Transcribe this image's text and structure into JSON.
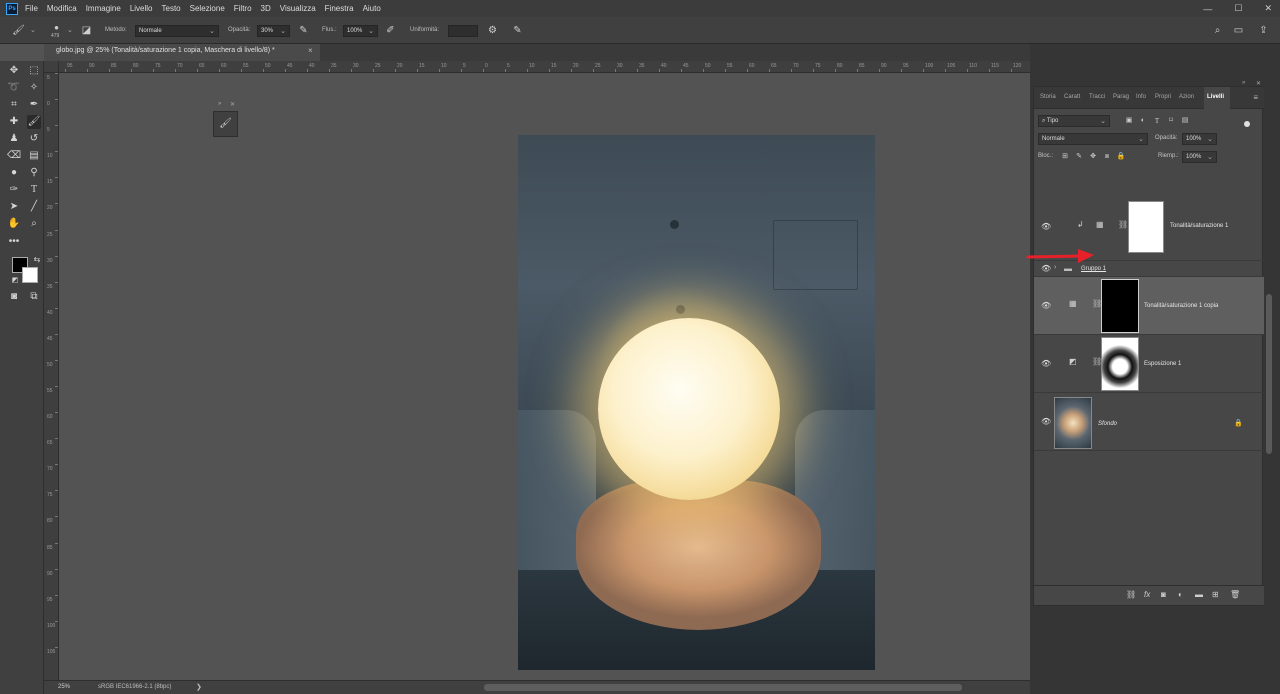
{
  "menubar": {
    "app_icon": "Ps",
    "items": [
      "File",
      "Modifica",
      "Immagine",
      "Livello",
      "Testo",
      "Selezione",
      "Filtro",
      "3D",
      "Visualizza",
      "Finestra",
      "Aiuto"
    ]
  },
  "options_bar": {
    "brush_size": "479",
    "mode_label": "Metodo:",
    "mode_value": "Normale",
    "opacity_label": "Opacità:",
    "opacity_value": "30%",
    "flow_label": "Flus.:",
    "flow_value": "100%",
    "smoothing_label": "Uniformità:"
  },
  "document": {
    "tab_title": "globo.jpg @ 25% (Tonalità/saturazione 1 copia, Maschera di livello/8) *",
    "close": "×"
  },
  "rulers": {
    "horizontal": [
      "95",
      "90",
      "85",
      "80",
      "75",
      "70",
      "65",
      "60",
      "55",
      "50",
      "45",
      "40",
      "35",
      "30",
      "25",
      "20",
      "15",
      "10",
      "5",
      "0",
      "5",
      "10",
      "15",
      "20",
      "25",
      "30",
      "35",
      "40",
      "45",
      "50",
      "55",
      "60",
      "65",
      "70",
      "75",
      "80",
      "85",
      "90",
      "95",
      "100",
      "105",
      "110",
      "115",
      "120"
    ],
    "vertical": [
      "5",
      "0",
      "5",
      "10",
      "15",
      "20",
      "25",
      "30",
      "35",
      "40",
      "45",
      "50",
      "55",
      "60",
      "65",
      "70",
      "75",
      "80",
      "85",
      "90",
      "95",
      "100",
      "105"
    ]
  },
  "status": {
    "zoom": "25%",
    "color_profile": "sRGB IEC61966-2.1 (8bpc)",
    "arrow": "❯"
  },
  "panel": {
    "tabs": [
      "Storia",
      "Caratt",
      "Tracci",
      "Parag",
      "Info",
      "Propri",
      "Azion",
      "Livelli"
    ],
    "active_tab": "Livelli",
    "filter_value": "Tipo",
    "blend_value": "Normale",
    "opacity_label": "Opacità:",
    "opacity_value": "100%",
    "lock_label": "Bloc.:",
    "fill_label": "Riemp.:",
    "fill_value": "100%",
    "layers": [
      {
        "name": "Tonalità/saturazione 1",
        "thumb_color": "#ffffff",
        "selected": false,
        "clipped": true
      },
      {
        "name": "Gruppo 1",
        "is_group": true
      },
      {
        "name": "Tonalità/saturazione 1 copia",
        "thumb_color": "#000000",
        "selected": true
      },
      {
        "name": "Esposizione 1",
        "thumb_color": "#ffffff",
        "selected": false
      },
      {
        "name": "Sfondo",
        "is_background": true,
        "locked": true
      }
    ]
  },
  "colors": {
    "foreground": "#000000",
    "background": "#ffffff",
    "annotation_arrow": "#e8202a",
    "accent": "#31a8ff"
  }
}
